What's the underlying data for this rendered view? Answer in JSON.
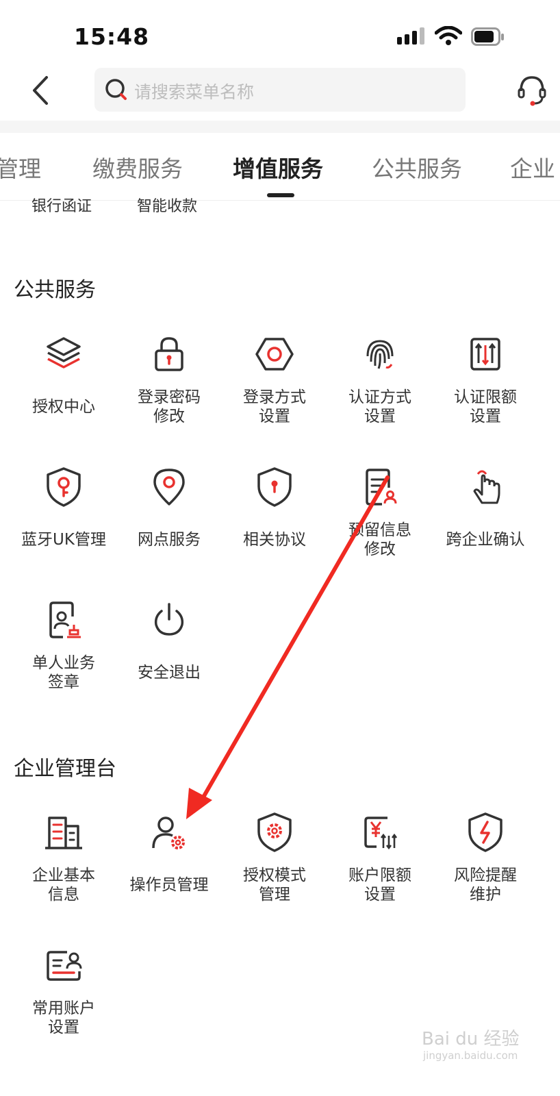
{
  "status_bar": {
    "time": "15:48"
  },
  "search": {
    "placeholder": "请搜索菜单名称"
  },
  "tabs": [
    "管理",
    "缴费服务",
    "增值服务",
    "公共服务",
    "企业"
  ],
  "cut_items": [
    "银行函证",
    "智能收款"
  ],
  "sections": {
    "public": {
      "title": "公共服务",
      "items": [
        {
          "label": "授权中心",
          "icon": "layers-icon"
        },
        {
          "label": "登录密码\n修改",
          "icon": "lock-icon"
        },
        {
          "label": "登录方式\n设置",
          "icon": "hexagon-icon"
        },
        {
          "label": "认证方式\n设置",
          "icon": "fingerprint-icon"
        },
        {
          "label": "认证限额\n设置",
          "icon": "limit-arrows-icon"
        },
        {
          "label": "蓝牙UK管理",
          "icon": "shield-key-icon"
        },
        {
          "label": "网点服务",
          "icon": "location-pin-icon"
        },
        {
          "label": "相关协议",
          "icon": "shield-keyhole-icon"
        },
        {
          "label": "预留信息\n修改",
          "icon": "document-user-icon"
        },
        {
          "label": "跨企业确认",
          "icon": "touch-hand-icon"
        },
        {
          "label": "单人业务\n签章",
          "icon": "seal-document-icon"
        },
        {
          "label": "安全退出",
          "icon": "power-icon"
        }
      ]
    },
    "enterprise": {
      "title": "企业管理台",
      "items": [
        {
          "label": "企业基本\n信息",
          "icon": "building-icon"
        },
        {
          "label": "操作员管理",
          "icon": "user-gear-icon"
        },
        {
          "label": "授权模式\n管理",
          "icon": "shield-gear-icon"
        },
        {
          "label": "账户限额\n设置",
          "icon": "yuan-limit-icon"
        },
        {
          "label": "风险提醒\n维护",
          "icon": "shield-bolt-icon"
        },
        {
          "label": "常用账户\n设置",
          "icon": "account-card-icon"
        }
      ]
    }
  },
  "colors": {
    "accent": "#e8322f",
    "icon": "#333333",
    "arrow": "#f02a22"
  },
  "watermark": {
    "main": "Bai du 经验",
    "sub": "jingyan.baidu.com"
  }
}
